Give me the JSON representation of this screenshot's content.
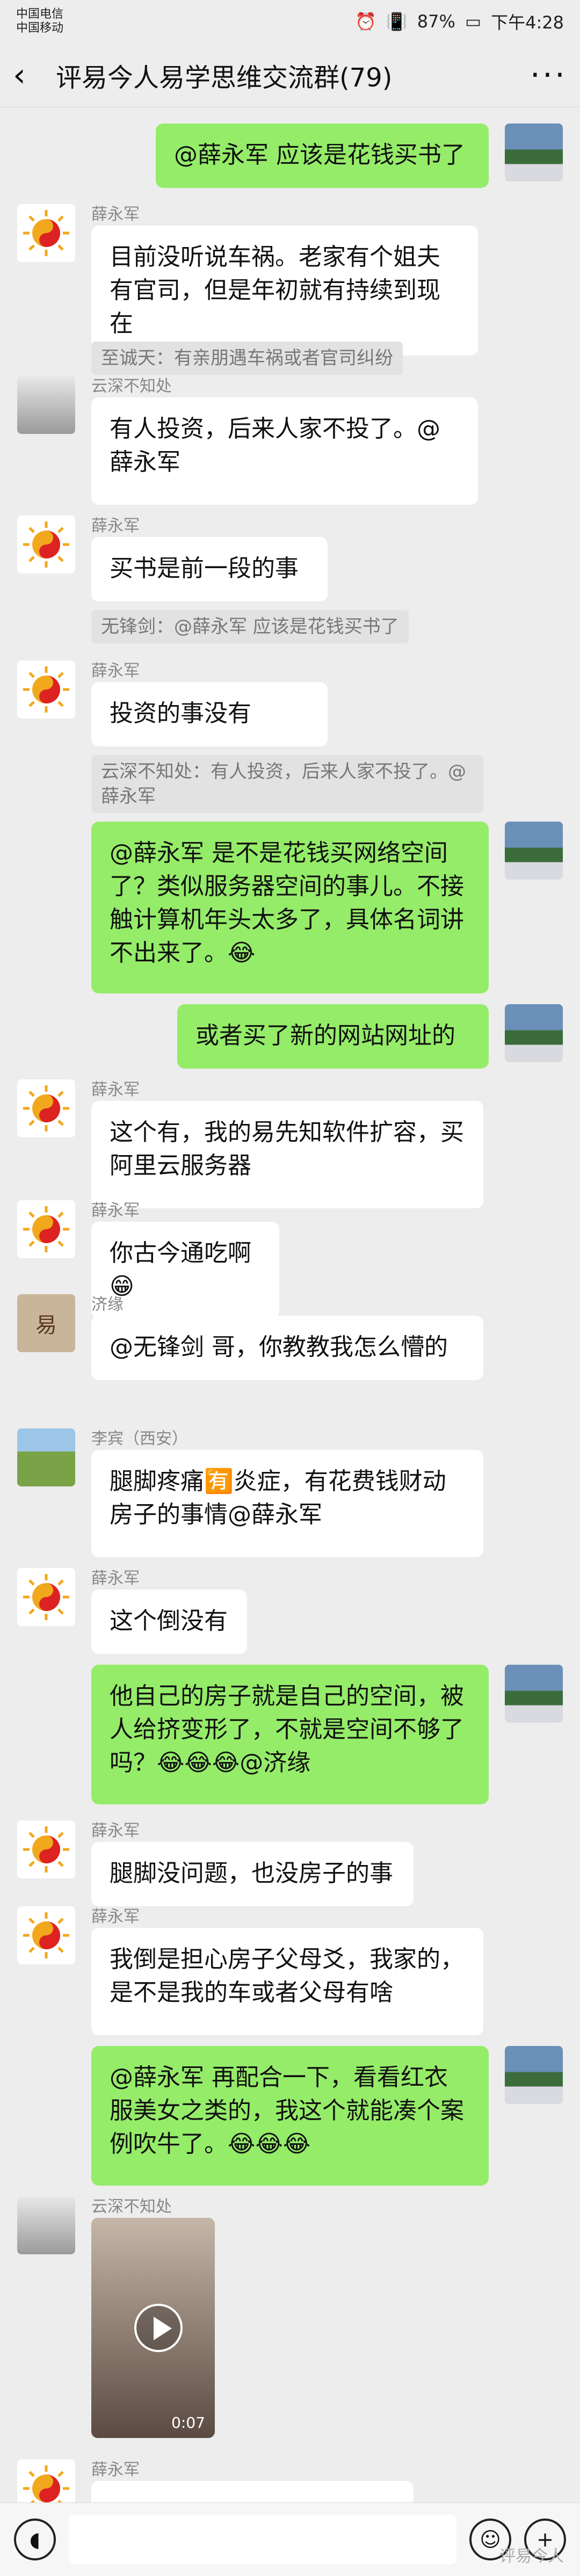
{
  "status": {
    "carrier1": "中国电信",
    "carrier2": "中国移动",
    "battery": "87%",
    "time": "下午4:28"
  },
  "header": {
    "title": "评易今人易学思维交流群(79)"
  },
  "messages": [
    {
      "id": "m1",
      "side": "right",
      "sender": "",
      "text": "@薛永军  应该是花钱买书了",
      "avatar": "landscape"
    },
    {
      "id": "m2",
      "side": "left",
      "sender": "薛永军",
      "text": "目前没听说车祸。老家有个姐夫有官司，但是年初就有持续到现在",
      "quote": "至诚天：有亲朋遇车祸或者官司纠纷",
      "avatar": "sun"
    },
    {
      "id": "m3",
      "side": "left",
      "sender": "云深不知处",
      "text": "有人投资，后来人家不投了。@薛永军",
      "avatar": "girl"
    },
    {
      "id": "m4",
      "side": "left",
      "sender": "薛永军",
      "text": "买书是前一段的事",
      "quote": "无锋剑：@薛永军 应该是花钱买书了",
      "avatar": "sun"
    },
    {
      "id": "m5",
      "side": "left",
      "sender": "薛永军",
      "text": "投资的事没有",
      "quote": "云深不知处：有人投资，后来人家不投了。@薛永军",
      "avatar": "sun"
    },
    {
      "id": "m6",
      "side": "right",
      "sender": "",
      "text": "@薛永军  是不是花钱买网络空间了？类似服务器空间的事儿。不接触计算机年头太多了，具体名词讲不出来了。😂",
      "avatar": "landscape"
    },
    {
      "id": "m7",
      "side": "right",
      "sender": "",
      "text": "或者买了新的网站网址的",
      "avatar": "landscape"
    },
    {
      "id": "m8",
      "side": "left",
      "sender": "薛永军",
      "text": "这个有，我的易先知软件扩容，买阿里云服务器",
      "avatar": "sun"
    },
    {
      "id": "m9",
      "side": "left",
      "sender": "薛永军",
      "text": "你古今通吃啊😁",
      "avatar": "sun"
    },
    {
      "id": "m10",
      "side": "left",
      "sender": "济缘",
      "text": "@无锋剑  哥，你教教我怎么懵的",
      "avatar": "book"
    },
    {
      "id": "m11",
      "side": "left",
      "sender": "李宾（西安）",
      "text": "腿脚疼痛🈶炎症，有花费钱财动房子的事情@薛永军",
      "avatar": "house"
    },
    {
      "id": "m12",
      "side": "left",
      "sender": "薛永军",
      "text": "这个倒没有",
      "avatar": "sun"
    },
    {
      "id": "m13",
      "side": "right",
      "sender": "",
      "text": "他自己的房子就是自己的空间，被人给挤变形了，不就是空间不够了吗？😂😂😂@济缘",
      "avatar": "landscape"
    },
    {
      "id": "m14",
      "side": "left",
      "sender": "薛永军",
      "text": "腿脚没问题，也没房子的事",
      "avatar": "sun"
    },
    {
      "id": "m15",
      "side": "left",
      "sender": "薛永军",
      "text": "我倒是担心房子父母爻，我家的，是不是我的车或者父母有啥",
      "avatar": "sun"
    },
    {
      "id": "m16",
      "side": "right",
      "sender": "",
      "text": "@薛永军  再配合一下，看看红衣服美女之类的，我这个就能凑个案例吹牛了。😂😂😂",
      "avatar": "landscape"
    },
    {
      "id": "m17",
      "side": "left",
      "sender": "云深不知处",
      "video_duration": "0:07",
      "avatar": "girl"
    },
    {
      "id": "m18",
      "side": "left",
      "sender": "薛永军",
      "text": "",
      "avatar": "sun"
    }
  ],
  "input": {
    "watermark": "评易今人"
  }
}
